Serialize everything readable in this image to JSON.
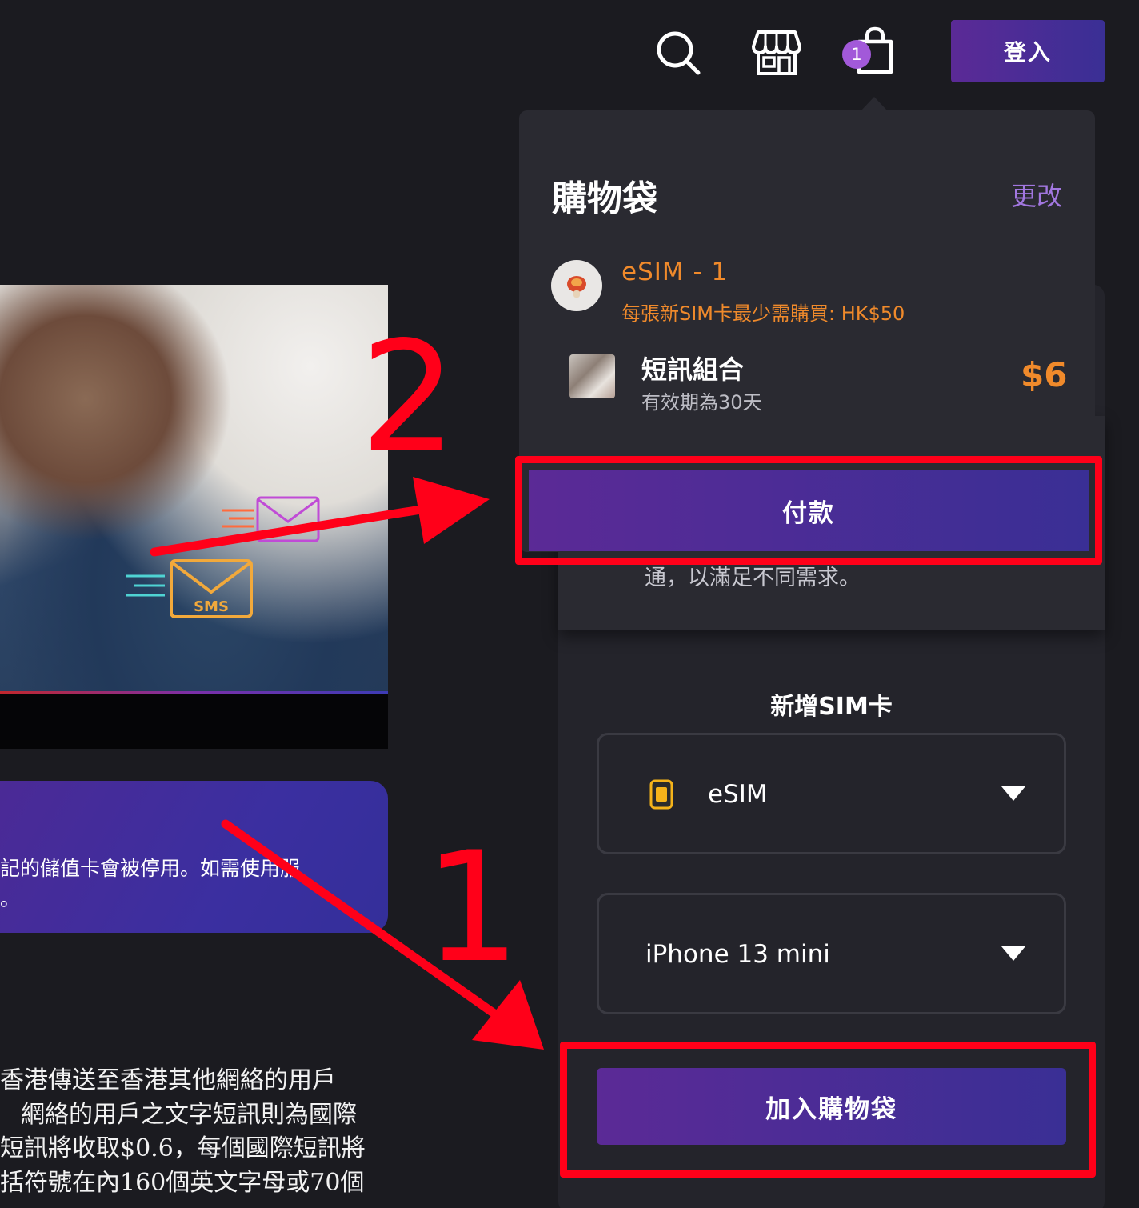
{
  "header": {
    "login_label": "登入",
    "cart_count": "1",
    "icons": [
      "search-icon",
      "store-icon",
      "shopping-bag-icon"
    ]
  },
  "hero": {
    "badge_text": "SMS"
  },
  "notice": {
    "line1": "記的儲值卡會被停用。如需使用服",
    "line2": "。"
  },
  "paragraph": {
    "lines": [
      "香港傳送至香港其他網絡的用戶",
      "網絡的用戶之文字短訊則為國際",
      "短訊將收取$0.6，每個國際短訊將",
      "括符號在內160個英文字母或70個"
    ]
  },
  "cart": {
    "title": "購物袋",
    "edit_label": "更改",
    "sim": {
      "name": "eSIM - 1",
      "min_purchase": "每張新SIM卡最少需購買: HK$50"
    },
    "item": {
      "name": "短訊組合",
      "validity": "有效期為30天",
      "price": "$6"
    },
    "pay_label": "付款"
  },
  "behind": {
    "partial_text": "通，以滿足不同需求。"
  },
  "add_sim": {
    "title": "新增SIM卡",
    "sim_type": "eSIM",
    "device": "iPhone 13 mini",
    "add_label": "加入購物袋"
  },
  "annotations": {
    "step1": "1",
    "step2": "2",
    "color": "#ff0019"
  }
}
